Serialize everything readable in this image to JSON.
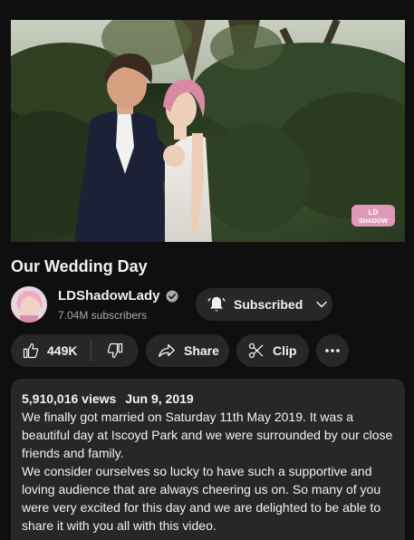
{
  "video": {
    "title": "Our Wedding Day",
    "thumbnail_icon": "wedding-scene",
    "watermark_icon": "ldshadowlady-logo"
  },
  "channel": {
    "name": "LDShadowLady",
    "verified_icon": "verified-check-icon",
    "subscribers": "7.04M subscribers",
    "subscribe_label": "Subscribed"
  },
  "actions": {
    "likes": "449K",
    "share_label": "Share",
    "clip_label": "Clip"
  },
  "description": {
    "views": "5,910,016 views",
    "date": "Jun 9, 2019",
    "paragraph1": "We finally got married on Saturday 11th May 2019. It was a beautiful day at Iscoyd Park and we were surrounded by our close friends and family.",
    "paragraph2": "We consider ourselves so lucky to have such a supportive and loving audience that are always cheering us on. So many of you were very excited for this day and we are delighted to be able to share it with you all with this video."
  },
  "colors": {
    "background": "#0f0f0f",
    "surface": "#272727",
    "text": "#f1f1f1",
    "secondary_text": "#aaaaaa"
  }
}
